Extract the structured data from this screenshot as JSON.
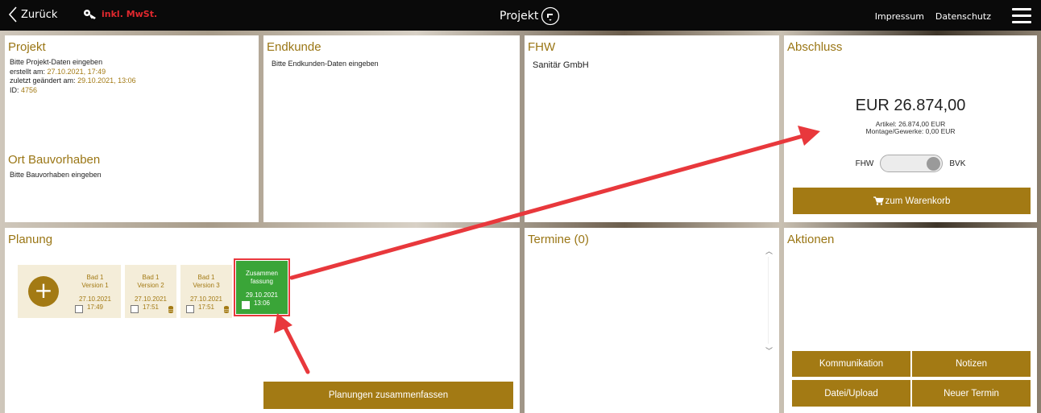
{
  "topbar": {
    "back_label": "Zurück",
    "mwst_label": "inkl. MwSt.",
    "title": "Projekt",
    "links": [
      "Impressum",
      "Datenschutz"
    ]
  },
  "projekt": {
    "title": "Projekt",
    "prompt": "Bitte Projekt-Daten eingeben",
    "created_label": "erstellt am:",
    "created_value": "27.10.2021, 17:49",
    "changed_label": "zuletzt geändert am:",
    "changed_value": "29.10.2021, 13:06",
    "id_label": "ID:",
    "id_value": "4756",
    "ort_title": "Ort Bauvorhaben",
    "ort_prompt": "Bitte Bauvorhaben eingeben"
  },
  "endkunde": {
    "title": "Endkunde",
    "prompt": "Bitte Endkunden-Daten eingeben"
  },
  "fhw": {
    "title": "FHW",
    "company": "Sanitär GmbH"
  },
  "abschluss": {
    "title": "Abschluss",
    "total": "EUR 26.874,00",
    "artikel": "Artikel: 26.874,00 EUR",
    "montage": "Montage/Gewerke: 0,00 EUR",
    "toggle_left": "FHW",
    "toggle_right": "BVK",
    "cart_button": "zum Warenkorb"
  },
  "planung": {
    "title": "Planung",
    "versions": [
      {
        "line1": "Bad 1",
        "line2": "Version 1",
        "date": "27.10.2021",
        "time": "17:49",
        "checked": false
      },
      {
        "line1": "Bad 1",
        "line2": "Version 2",
        "date": "27.10.2021",
        "time": "17:51",
        "checked": false
      },
      {
        "line1": "Bad 1",
        "line2": "Version 3",
        "date": "27.10.2021",
        "time": "17:51",
        "checked": false
      },
      {
        "line1": "Zusammen",
        "line2": "fassung",
        "date": "29.10.2021",
        "time": "13:06",
        "checked": false
      }
    ],
    "merge_button": "Planungen zusammenfassen"
  },
  "termine": {
    "title": "Termine (0)"
  },
  "aktionen": {
    "title": "Aktionen",
    "buttons": [
      "Kommunikation",
      "Notizen",
      "Datei/Upload",
      "Neuer Termin"
    ]
  },
  "colors": {
    "accent": "#a37a14",
    "highlight": "#3aa538",
    "annotation": "#e8383c"
  }
}
